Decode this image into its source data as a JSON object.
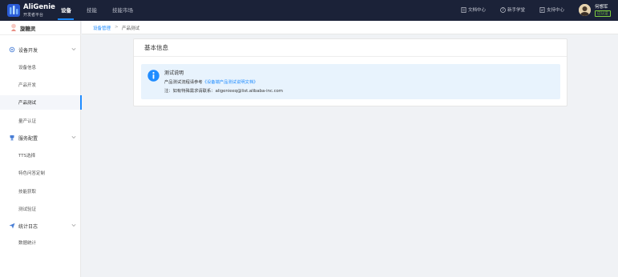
{
  "brand": {
    "title": "AliGenie",
    "subtitle": "开发者平台"
  },
  "topnav": [
    {
      "label": "设备",
      "active": true
    },
    {
      "label": "技能",
      "active": false
    },
    {
      "label": "技能市场",
      "active": false
    }
  ],
  "tools": [
    {
      "label": "文档中心",
      "icon": "document-icon"
    },
    {
      "label": "新手学堂",
      "icon": "help-circle-icon"
    },
    {
      "label": "支持中心",
      "icon": "support-icon"
    }
  ],
  "user": {
    "name": "何想军",
    "badge": "已认证"
  },
  "sidebar": {
    "title": "旋糖灵",
    "sections": [
      {
        "label": "设备开发",
        "icon": "gear-icon",
        "items": [
          "设备信息",
          "产品开发",
          "产品测试",
          "量产认证"
        ]
      },
      {
        "label": "服务配置",
        "icon": "trophy-icon",
        "items": [
          "TTS选择",
          "特色问答定制",
          "技能获取",
          "测试验证"
        ]
      },
      {
        "label": "统计日志",
        "icon": "send-icon",
        "items": [
          "数据统计"
        ]
      }
    ],
    "active_item": "产品测试"
  },
  "breadcrumb": {
    "parent": "设备管理",
    "separator": ">",
    "current": "产品测试"
  },
  "card": {
    "title": "基本信息",
    "notice": {
      "title": "测试说明",
      "line1_prefix": "产品测试流程请参考",
      "line1_link": "《设备端产品测试说明文档》",
      "line2": "注：如有特殊需求请联系：aligenieeq@list.alibaba-inc.com"
    }
  },
  "colors": {
    "topbar": "#1b2238",
    "accent": "#1f8cff",
    "notice_bg": "#e8f3fd",
    "badge": "#7fcf3f"
  }
}
